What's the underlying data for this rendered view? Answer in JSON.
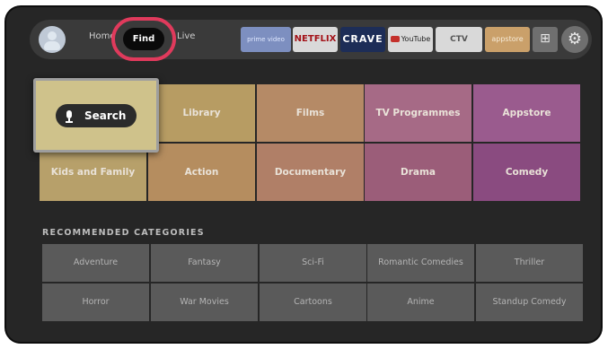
{
  "nav": {
    "home_label": "Home",
    "find_label": "Find",
    "live_label": "Live"
  },
  "apps": {
    "prime": "prime video",
    "netflix": "NETFLIX",
    "crave": "CRAVE",
    "youtube": "YouTube",
    "ctv": "CTV",
    "appstore": "appstore"
  },
  "categories": {
    "search": "Search",
    "library": "Library",
    "films": "Films",
    "tv": "TV Programmes",
    "appstore": "Appstore",
    "kids": "Kids and Family",
    "action": "Action",
    "documentary": "Documentary",
    "drama": "Drama",
    "comedy": "Comedy"
  },
  "recommended": {
    "title": "RECOMMENDED CATEGORIES",
    "items": [
      "Adventure",
      "Fantasy",
      "Sci-Fi",
      "Romantic Comedies",
      "Thriller",
      "Horror",
      "War Movies",
      "Cartoons",
      "Anime",
      "Standup Comedy"
    ]
  },
  "icons": {
    "profile": "avatar-icon",
    "grid": "app-grid-icon",
    "settings": "gear-icon",
    "mic": "microphone-icon"
  },
  "colors": {
    "highlight_ring": "#e03a5c",
    "device_bg": "#262626"
  }
}
